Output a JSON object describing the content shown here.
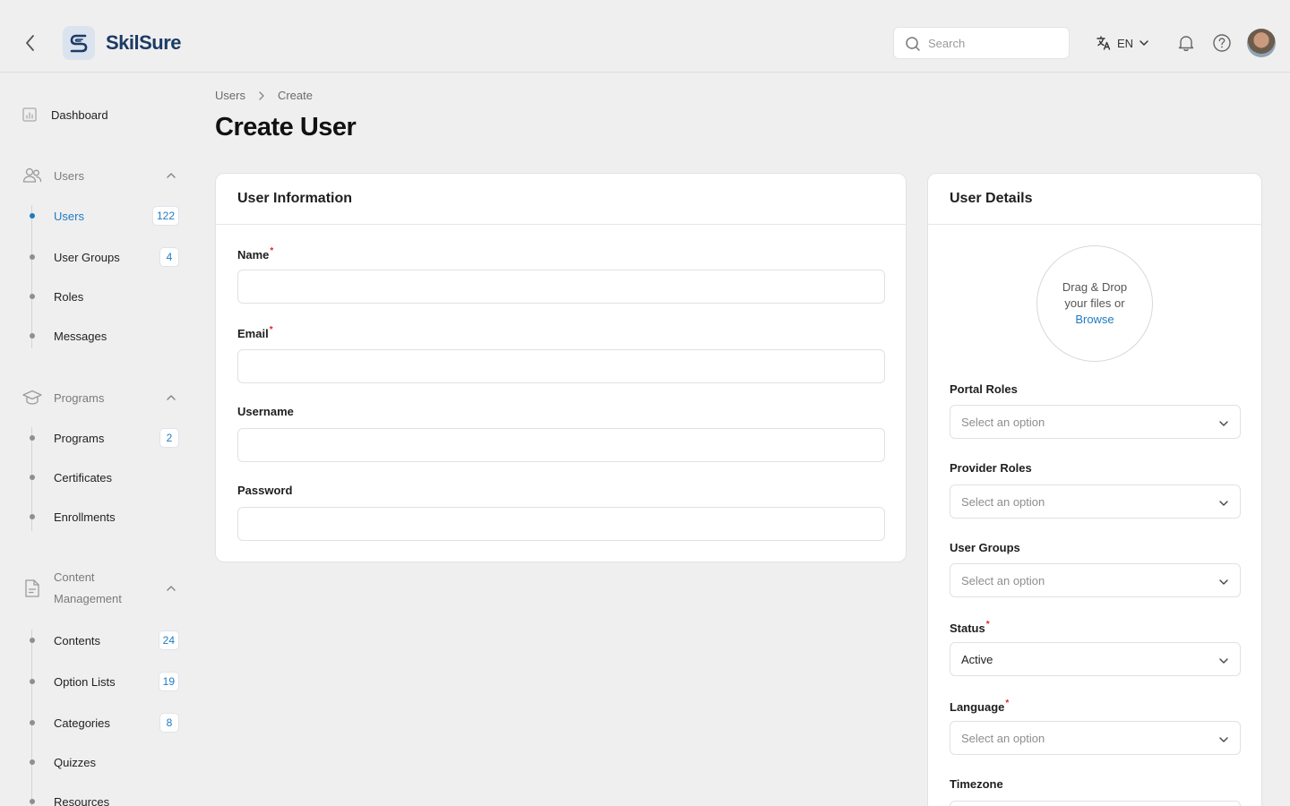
{
  "header": {
    "app_name": "SkilSure",
    "search_placeholder": "Search",
    "language": "EN"
  },
  "sidebar": {
    "dashboard": "Dashboard",
    "groups": [
      {
        "label": "Users",
        "items": [
          {
            "label": "Users",
            "badge": "122",
            "active": true
          },
          {
            "label": "User Groups",
            "badge": "4"
          },
          {
            "label": "Roles"
          },
          {
            "label": "Messages"
          }
        ]
      },
      {
        "label": "Programs",
        "items": [
          {
            "label": "Programs",
            "badge": "2"
          },
          {
            "label": "Certificates"
          },
          {
            "label": "Enrollments"
          }
        ]
      },
      {
        "label_line1": "Content",
        "label_line2": "Management",
        "items": [
          {
            "label": "Contents",
            "badge": "24"
          },
          {
            "label": "Option Lists",
            "badge": "19"
          },
          {
            "label": "Categories",
            "badge": "8"
          },
          {
            "label": "Quizzes"
          },
          {
            "label": "Resources"
          }
        ]
      }
    ]
  },
  "breadcrumb": {
    "parent": "Users",
    "current": "Create"
  },
  "page_title": "Create User",
  "user_info": {
    "title": "User Information",
    "name_label": "Name",
    "email_label": "Email",
    "username_label": "Username",
    "password_label": "Password"
  },
  "user_details": {
    "title": "User Details",
    "drop_line1": "Drag & Drop",
    "drop_line2": "your files or",
    "browse": "Browse",
    "portal_roles_label": "Portal Roles",
    "provider_roles_label": "Provider Roles",
    "user_groups_label": "User Groups",
    "status_label": "Status",
    "status_value": "Active",
    "language_label": "Language",
    "timezone_label": "Timezone",
    "select_placeholder": "Select an option"
  },
  "colors": {
    "accent": "#1f7bc1",
    "required": "#e0262b",
    "brand": "#1c3b66"
  }
}
